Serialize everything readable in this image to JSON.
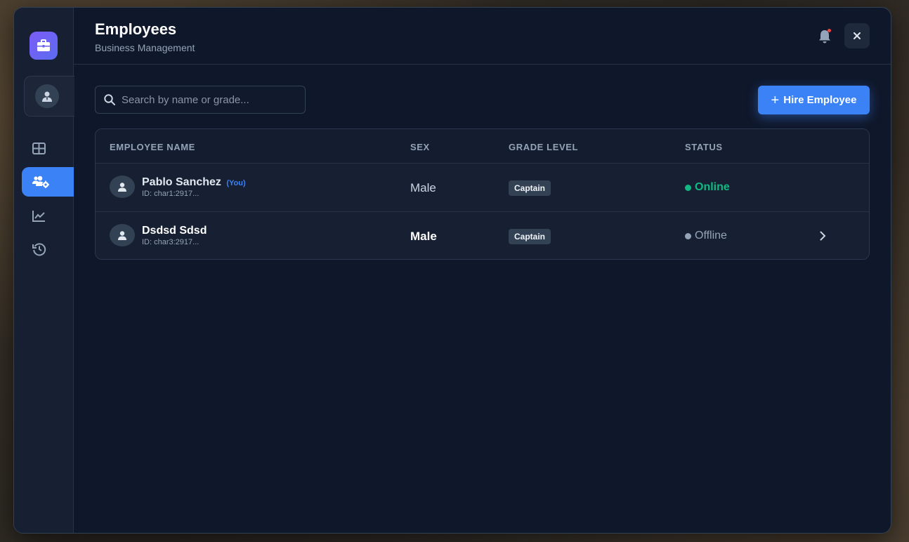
{
  "header": {
    "title": "Employees",
    "subtitle": "Business Management"
  },
  "search": {
    "placeholder": "Search by name or grade...",
    "value": ""
  },
  "actions": {
    "hire_label": "Hire Employee"
  },
  "sidebar": {
    "items": [
      {
        "name": "dashboard",
        "icon": "grid-icon",
        "active": false
      },
      {
        "name": "employees",
        "icon": "users-gear-icon",
        "active": true
      },
      {
        "name": "analytics",
        "icon": "chart-line-icon",
        "active": false
      },
      {
        "name": "history",
        "icon": "history-icon",
        "active": false
      }
    ]
  },
  "table": {
    "columns": [
      "EMPLOYEE NAME",
      "SEX",
      "GRADE LEVEL",
      "STATUS"
    ],
    "rows": [
      {
        "name": "Pablo Sanchez",
        "you": "(You)",
        "id": "ID: char1:2917...",
        "sex": "Male",
        "grade": "Captain",
        "status": "Online"
      },
      {
        "name": "Dsdsd Sdsd",
        "you": "",
        "id": "ID: char3:2917...",
        "sex": "Male",
        "grade": "Captain",
        "status": "Offline"
      }
    ]
  },
  "colors": {
    "accent": "#3b82f6",
    "online": "#10b981",
    "offline": "#94a3b8",
    "notification": "#ef4444"
  }
}
